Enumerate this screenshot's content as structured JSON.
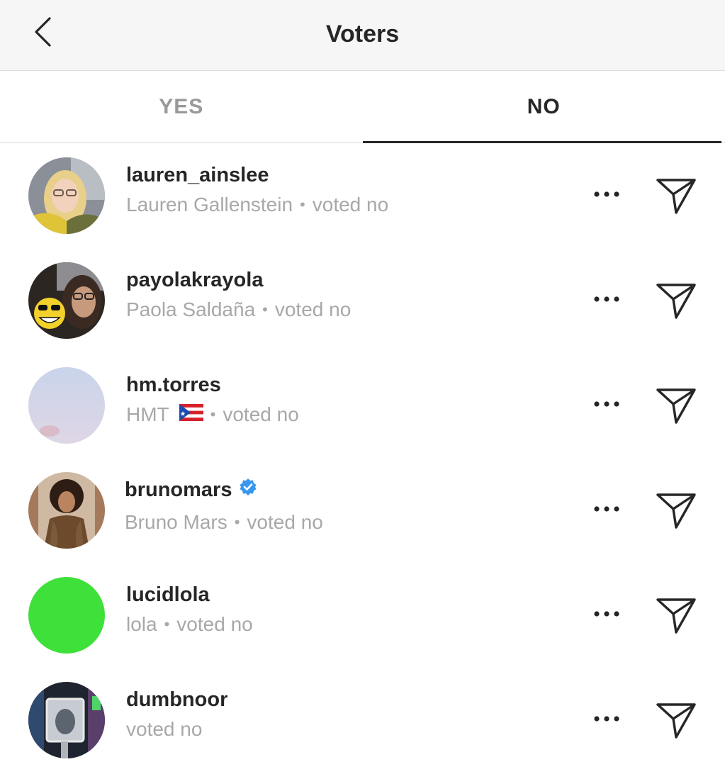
{
  "header": {
    "title": "Voters",
    "back_icon": "chevron-left-icon"
  },
  "tabs": [
    {
      "label": "YES",
      "active": false
    },
    {
      "label": "NO",
      "active": true
    }
  ],
  "voters": [
    {
      "username": "lauren_ainslee",
      "name": "Lauren Gallenstein",
      "separator": "•",
      "status": "voted no",
      "verified": false
    },
    {
      "username": "payolakrayola",
      "name": "Paola Saldaña",
      "separator": "•",
      "status": "voted no",
      "verified": false
    },
    {
      "username": "hm.torres",
      "name": "HMT",
      "separator": "•",
      "status": "voted no",
      "verified": false,
      "flag": "puerto-rico-flag"
    },
    {
      "username": "brunomars",
      "name": "Bruno Mars",
      "separator": "•",
      "status": "voted no",
      "verified": true
    },
    {
      "username": "lucidlola",
      "name": "lola",
      "separator": "•",
      "status": "voted no",
      "verified": false
    },
    {
      "username": "dumbnoor",
      "name": "",
      "separator": "",
      "status": "voted no",
      "verified": false
    }
  ],
  "icons": {
    "more": "more-options-icon",
    "send": "send-direct-icon",
    "verified": "verified-badge-icon"
  },
  "colors": {
    "verified_blue": "#3897f0",
    "lucidlola_avatar": "#3ee03a",
    "secondary_text": "#a8a8a8",
    "inactive_tab": "#999999"
  }
}
